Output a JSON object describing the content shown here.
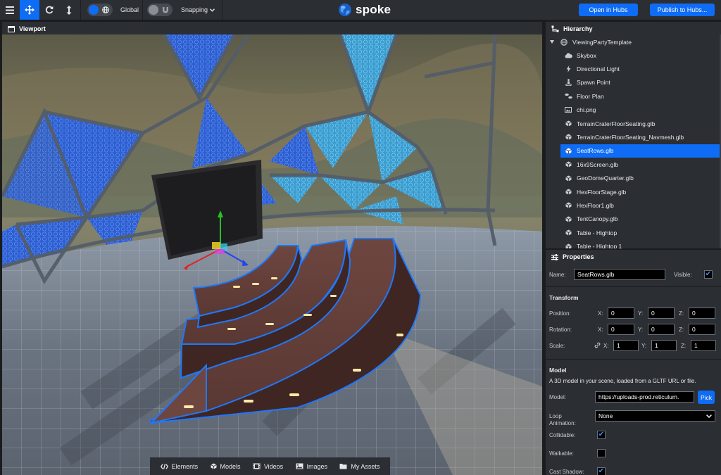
{
  "toolbar": {
    "menu_icon": "menu-icon",
    "translate_icon": "translate-icon",
    "rotate_icon": "rotate-icon",
    "scale_icon": "scale-icon",
    "space_label": "Global",
    "snapping_label": "Snapping",
    "logo_text": "spoke",
    "open_hubs_label": "Open in Hubs",
    "publish_label": "Publish to Hubs..."
  },
  "viewport": {
    "title": "Viewport",
    "assets_tabs": [
      {
        "label": "Elements",
        "icon": "code-icon"
      },
      {
        "label": "Models",
        "icon": "cube-icon"
      },
      {
        "label": "Videos",
        "icon": "film-icon"
      },
      {
        "label": "Images",
        "icon": "image-icon"
      },
      {
        "label": "My Assets",
        "icon": "folder-icon"
      }
    ]
  },
  "hierarchy": {
    "title": "Hierarchy",
    "root": "ViewingPartyTemplate",
    "items": [
      {
        "label": "Skybox",
        "icon": "cloud-icon"
      },
      {
        "label": "Directional Light",
        "icon": "bolt-icon"
      },
      {
        "label": "Spawn Point",
        "icon": "street-view-icon"
      },
      {
        "label": "Floor Plan",
        "icon": "shoe-prints-icon"
      },
      {
        "label": "chi.png",
        "icon": "image-icon"
      },
      {
        "label": "TerrainCraterFloorSeating.glb",
        "icon": "cube-icon"
      },
      {
        "label": "TerrainCraterFloorSeating_Navmesh.glb",
        "icon": "cube-icon"
      },
      {
        "label": "SeatRows.glb",
        "icon": "cube-icon",
        "selected": true
      },
      {
        "label": "16x9Screen.glb",
        "icon": "cube-icon"
      },
      {
        "label": "GeoDomeQuarter.glb",
        "icon": "cube-icon"
      },
      {
        "label": "HexFloorStage.glb",
        "icon": "cube-icon"
      },
      {
        "label": "HexFloor1.glb",
        "icon": "cube-icon"
      },
      {
        "label": "TentCanopy.glb",
        "icon": "cube-icon"
      },
      {
        "label": "Table - Hightop",
        "icon": "cube-icon"
      },
      {
        "label": "Table - Hightop 1",
        "icon": "cube-icon"
      }
    ]
  },
  "properties": {
    "title": "Properties",
    "name_label": "Name:",
    "name_value": "SeatRows.glb",
    "visible_label": "Visible:",
    "visible": true,
    "transform_title": "Transform",
    "position_label": "Position:",
    "rotation_label": "Rotation:",
    "scale_label": "Scale:",
    "axis_x": "X:",
    "axis_y": "Y:",
    "axis_z": "Z:",
    "position": {
      "x": "0",
      "y": "0",
      "z": "0"
    },
    "rotation": {
      "x": "0",
      "y": "0",
      "z": "0"
    },
    "scale": {
      "x": "1",
      "y": "1",
      "z": "1"
    },
    "model_title": "Model",
    "model_description": "A 3D model in your scene, loaded from a GLTF URL or file.",
    "model_label": "Model:",
    "model_url": "https://uploads-prod.reticulum.",
    "pick_label": "Pick",
    "loop_label_1": "Loop",
    "loop_label_2": "Animation:",
    "loop_value": "None",
    "collidable_label": "Collidable:",
    "collidable": true,
    "walkable_label": "Walkable:",
    "walkable": false,
    "cast_shadow_label": "Cast Shadow:",
    "cast_shadow": true
  },
  "colors": {
    "accent": "#0e6cf5",
    "panel": "#2b2e33",
    "background": "#1b1c1e",
    "gizmo_x": "#e02424",
    "gizmo_y": "#22c322",
    "gizmo_z": "#2244ee"
  }
}
